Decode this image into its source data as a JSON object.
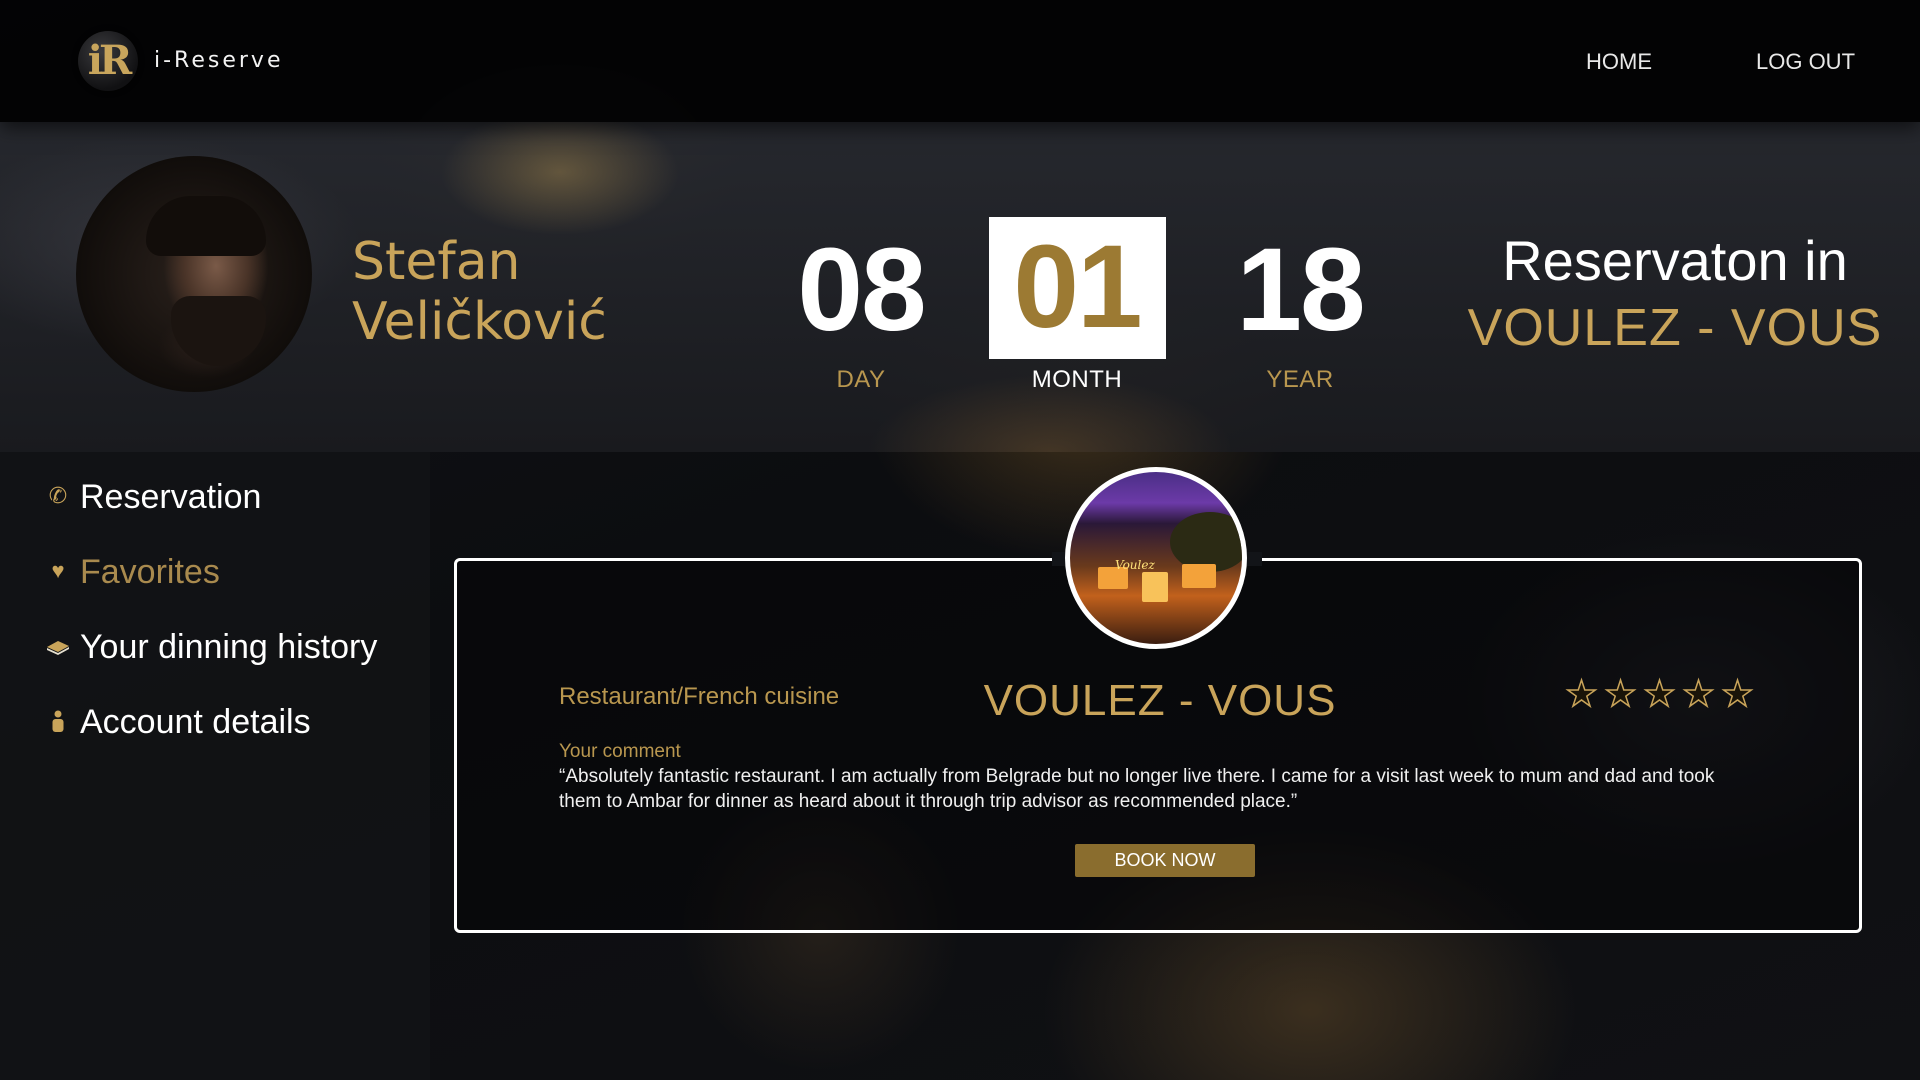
{
  "header": {
    "logo_letter": "iR",
    "brand": "i-Reserve",
    "nav": {
      "home": "HOME",
      "logout": "LOG OUT"
    }
  },
  "profile": {
    "first_name": "Stefan",
    "last_name": "Veličković"
  },
  "date": {
    "day": "08",
    "month": "01",
    "year": "18",
    "day_label": "DAY",
    "month_label": "MONTH",
    "year_label": "YEAR"
  },
  "reservation": {
    "title": "Reservaton in",
    "place": "VOULEZ - VOUS"
  },
  "sidebar": {
    "items": [
      {
        "label": "Reservation",
        "icon": "phone-icon",
        "active": false
      },
      {
        "label": "Favorites",
        "icon": "heart-icon",
        "active": true
      },
      {
        "label": "Your dinning history",
        "icon": "book-icon",
        "active": false
      },
      {
        "label": "Account details",
        "icon": "person-icon",
        "active": false
      }
    ]
  },
  "restaurant": {
    "type": "Restaurant/French cuisine",
    "name": "VOULEZ - VOUS",
    "rating": 5,
    "rating_max": 5,
    "photo_sign": "Voulez",
    "comment_label": "Your comment",
    "comment": "“Absolutely fantastic restaurant. I am actually from Belgrade but no longer live there. I came for a visit last week to mum and dad and took them to Ambar for dinner as heard about it through trip advisor as recommended place.”",
    "book_label": "BOOK NOW"
  },
  "colors": {
    "accent": "#c9a45a",
    "button": "#8a6d2e",
    "background": "#121418"
  }
}
